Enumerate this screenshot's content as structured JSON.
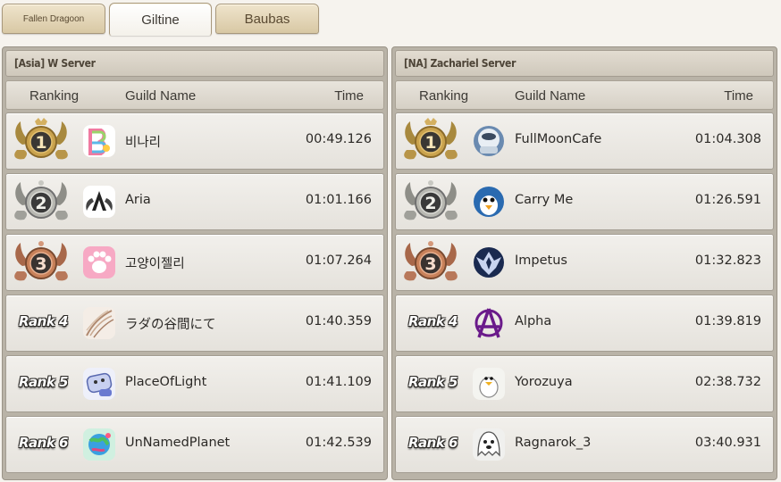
{
  "tabs": [
    {
      "label": "Fallen Dragoon",
      "active": false
    },
    {
      "label": "Giltine",
      "active": true
    },
    {
      "label": "Baubas",
      "active": false
    }
  ],
  "columns": {
    "ranking": "Ranking",
    "guild_name": "Guild Name",
    "time": "Time"
  },
  "medal_colors": {
    "gold": "#caa34e",
    "silver": "#b8b8b2",
    "bronze": "#c8815a"
  },
  "panels": [
    {
      "title": "[Asia] W Server",
      "rows": [
        {
          "rank": "1",
          "rank_label": "",
          "medal": "gold-medal-icon",
          "emblem": "rainbow-b-emblem-icon",
          "guild": "비나리",
          "time": "00:49.126"
        },
        {
          "rank": "2",
          "rank_label": "",
          "medal": "silver-medal-icon",
          "emblem": "winged-a-emblem-icon",
          "guild": "Aria",
          "time": "01:01.166"
        },
        {
          "rank": "3",
          "rank_label": "",
          "medal": "bronze-medal-icon",
          "emblem": "paw-emblem-icon",
          "guild": "고양이젤리",
          "time": "01:07.264"
        },
        {
          "rank": "4",
          "rank_label": "Rank 4",
          "medal": "",
          "emblem": "feather-emblem-icon",
          "guild": "ラダの谷間にて",
          "time": "01:40.359"
        },
        {
          "rank": "5",
          "rank_label": "Rank 5",
          "medal": "",
          "emblem": "character-emblem-icon",
          "guild": "PlaceOfLight",
          "time": "01:41.109"
        },
        {
          "rank": "6",
          "rank_label": "Rank 6",
          "medal": "",
          "emblem": "planet-emblem-icon",
          "guild": "UnNamedPlanet",
          "time": "01:42.539"
        }
      ]
    },
    {
      "title": "[NA] Zachariel Server",
      "rows": [
        {
          "rank": "1",
          "rank_label": "",
          "medal": "gold-medal-icon",
          "emblem": "astronaut-emblem-icon",
          "guild": "FullMoonCafe",
          "time": "01:04.308"
        },
        {
          "rank": "2",
          "rank_label": "",
          "medal": "silver-medal-icon",
          "emblem": "penguin-emblem-icon",
          "guild": "Carry Me",
          "time": "01:26.591"
        },
        {
          "rank": "3",
          "rank_label": "",
          "medal": "bronze-medal-icon",
          "emblem": "phoenix-emblem-icon",
          "guild": "Impetus",
          "time": "01:32.823"
        },
        {
          "rank": "4",
          "rank_label": "Rank 4",
          "medal": "",
          "emblem": "anarchy-a-emblem-icon",
          "guild": "Alpha",
          "time": "01:39.819"
        },
        {
          "rank": "5",
          "rank_label": "Rank 5",
          "medal": "",
          "emblem": "duck-emblem-icon",
          "guild": "Yorozuya",
          "time": "02:38.732"
        },
        {
          "rank": "6",
          "rank_label": "Rank 6",
          "medal": "",
          "emblem": "ghost-emblem-icon",
          "guild": "Ragnarok_3",
          "time": "03:40.931"
        }
      ]
    }
  ]
}
